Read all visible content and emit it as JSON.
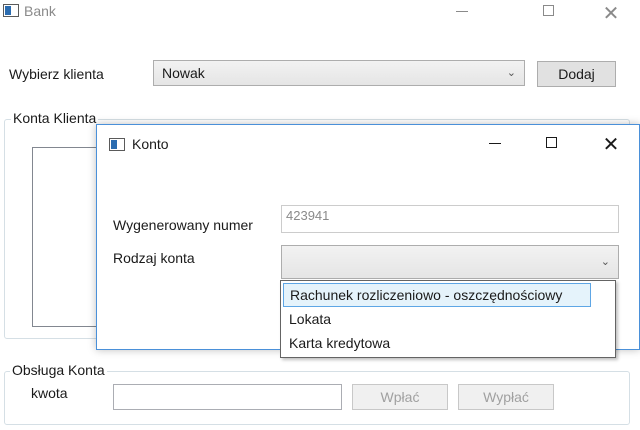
{
  "main_window": {
    "title": "Bank",
    "client_label": "Wybierz klienta",
    "client_selected": "Nowak",
    "add_button": "Dodaj",
    "accounts_group": "Konta Klienta",
    "service_group": "Obsługa Konta",
    "amount_label": "kwota",
    "amount_value": "",
    "deposit_button": "Wpłać",
    "withdraw_button": "Wypłać"
  },
  "dialog": {
    "title": "Konto",
    "number_label": "Wygenerowany numer",
    "number_value": "423941",
    "type_label": "Rodzaj konta",
    "type_selected": "",
    "options": [
      "Rachunek rozliczeniowo - oszczędnościowy",
      "Lokata",
      "Karta kredytowa"
    ]
  },
  "icons": {
    "minimize": "minimize-icon",
    "maximize": "maximize-icon",
    "close": "close-icon",
    "chevron": "chevron-down-icon"
  }
}
